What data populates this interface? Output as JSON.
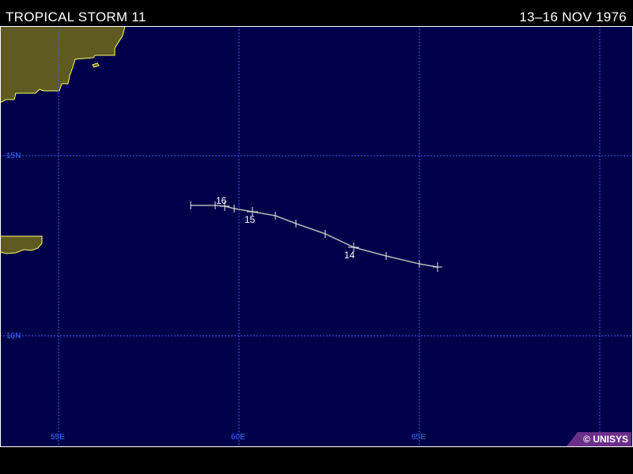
{
  "header": {
    "title": "TROPICAL STORM 11",
    "date_range": "13–16 NOV 1976"
  },
  "map": {
    "ocean_color": "#00004a",
    "land_color": "#5e5a21",
    "coast_color": "#ffff66",
    "grid_color": "#3b5bff",
    "track_color": "#b8b8b8",
    "lat_labels": [
      "15N",
      "10N"
    ],
    "lon_labels": [
      "55E",
      "60E",
      "65E"
    ]
  },
  "track": {
    "day_labels": [
      "16",
      "15",
      "14"
    ]
  },
  "credit": "© UNISYS"
}
